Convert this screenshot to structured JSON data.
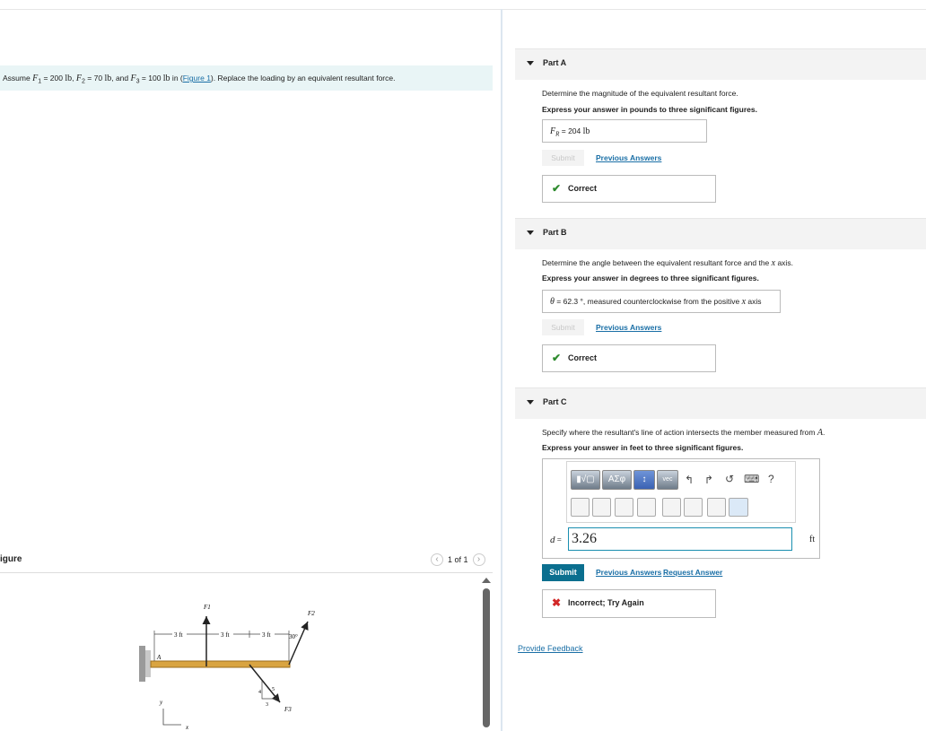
{
  "problem": {
    "pre": "Assume ",
    "f1": "F",
    "f1_sub": "1",
    "eq1": " = 200 ",
    "u1": "lb",
    "sep1": ", ",
    "f2": "F",
    "f2_sub": "2",
    "eq2": " = 70 ",
    "u2": "lb",
    "sep2": ", and ",
    "f3": "F",
    "f3_sub": "3",
    "eq3": " = 100 ",
    "u3": "lb",
    "mid": " in (",
    "figure_link": "Figure 1",
    "post": "). Replace the loading by an equivalent resultant force."
  },
  "figure_panel": {
    "title": "igure",
    "pager": "1 of 1",
    "prev_glyph": "‹",
    "next_glyph": "›",
    "labels": {
      "f1": "F1",
      "f2": "F2",
      "f3": "F3",
      "d1": "3 ft",
      "d2": "3 ft",
      "d3": "3 ft",
      "angle": "30°",
      "a": "A",
      "y": "y",
      "x": "x",
      "r4": "4",
      "r5": "5",
      "r3": "3"
    }
  },
  "part_a": {
    "label": "Part A",
    "question": "Determine the magnitude of the equivalent resultant force.",
    "instruction": "Express your answer in pounds to three significant figures.",
    "answer_var": "F",
    "answer_sub": "R",
    "answer_eq": " =  204 ",
    "answer_unit": "lb",
    "submit": "Submit",
    "previous_answers": "Previous Answers",
    "feedback_icon": "✔",
    "feedback": "Correct"
  },
  "part_b": {
    "label": "Part B",
    "question_pre": "Determine the angle between the equivalent resultant force and the ",
    "question_var": "x",
    "question_post": " axis.",
    "instruction": "Express your answer in degrees to three significant figures.",
    "answer_var": "θ",
    "answer_eq": " =  62.3 °, measured counterclockwise from the positive ",
    "answer_var2": "x",
    "answer_post": " axis",
    "submit": "Submit",
    "previous_answers": "Previous Answers",
    "feedback_icon": "✔",
    "feedback": "Correct"
  },
  "part_c": {
    "label": "Part C",
    "question_pre": "Specify where the resultant's line of action intersects the member measured from ",
    "question_var": "A",
    "question_post": ".",
    "instruction": "Express your answer in feet to three significant figures.",
    "toolbar": {
      "templates": "▮√▢",
      "greek": "ΑΣφ",
      "vector": "↕",
      "vec": "vec",
      "undo": "↰",
      "redo": "↱",
      "reset": "↺",
      "keyboard": "⌨",
      "help": "?"
    },
    "var": "d",
    "eq": " =",
    "value": "3.26",
    "unit": "ft",
    "submit": "Submit",
    "previous_answers": "Previous Answers",
    "request_answer": "Request Answer",
    "feedback_icon": "✖",
    "feedback": "Incorrect; Try Again"
  },
  "provide_feedback": "Provide Feedback",
  "colors": {
    "correct": "#2e8b2e",
    "incorrect": "#d22828",
    "submit_bg": "#0b6f8f",
    "link": "#1a6fa6",
    "problem_bg": "#e9f5f6"
  }
}
